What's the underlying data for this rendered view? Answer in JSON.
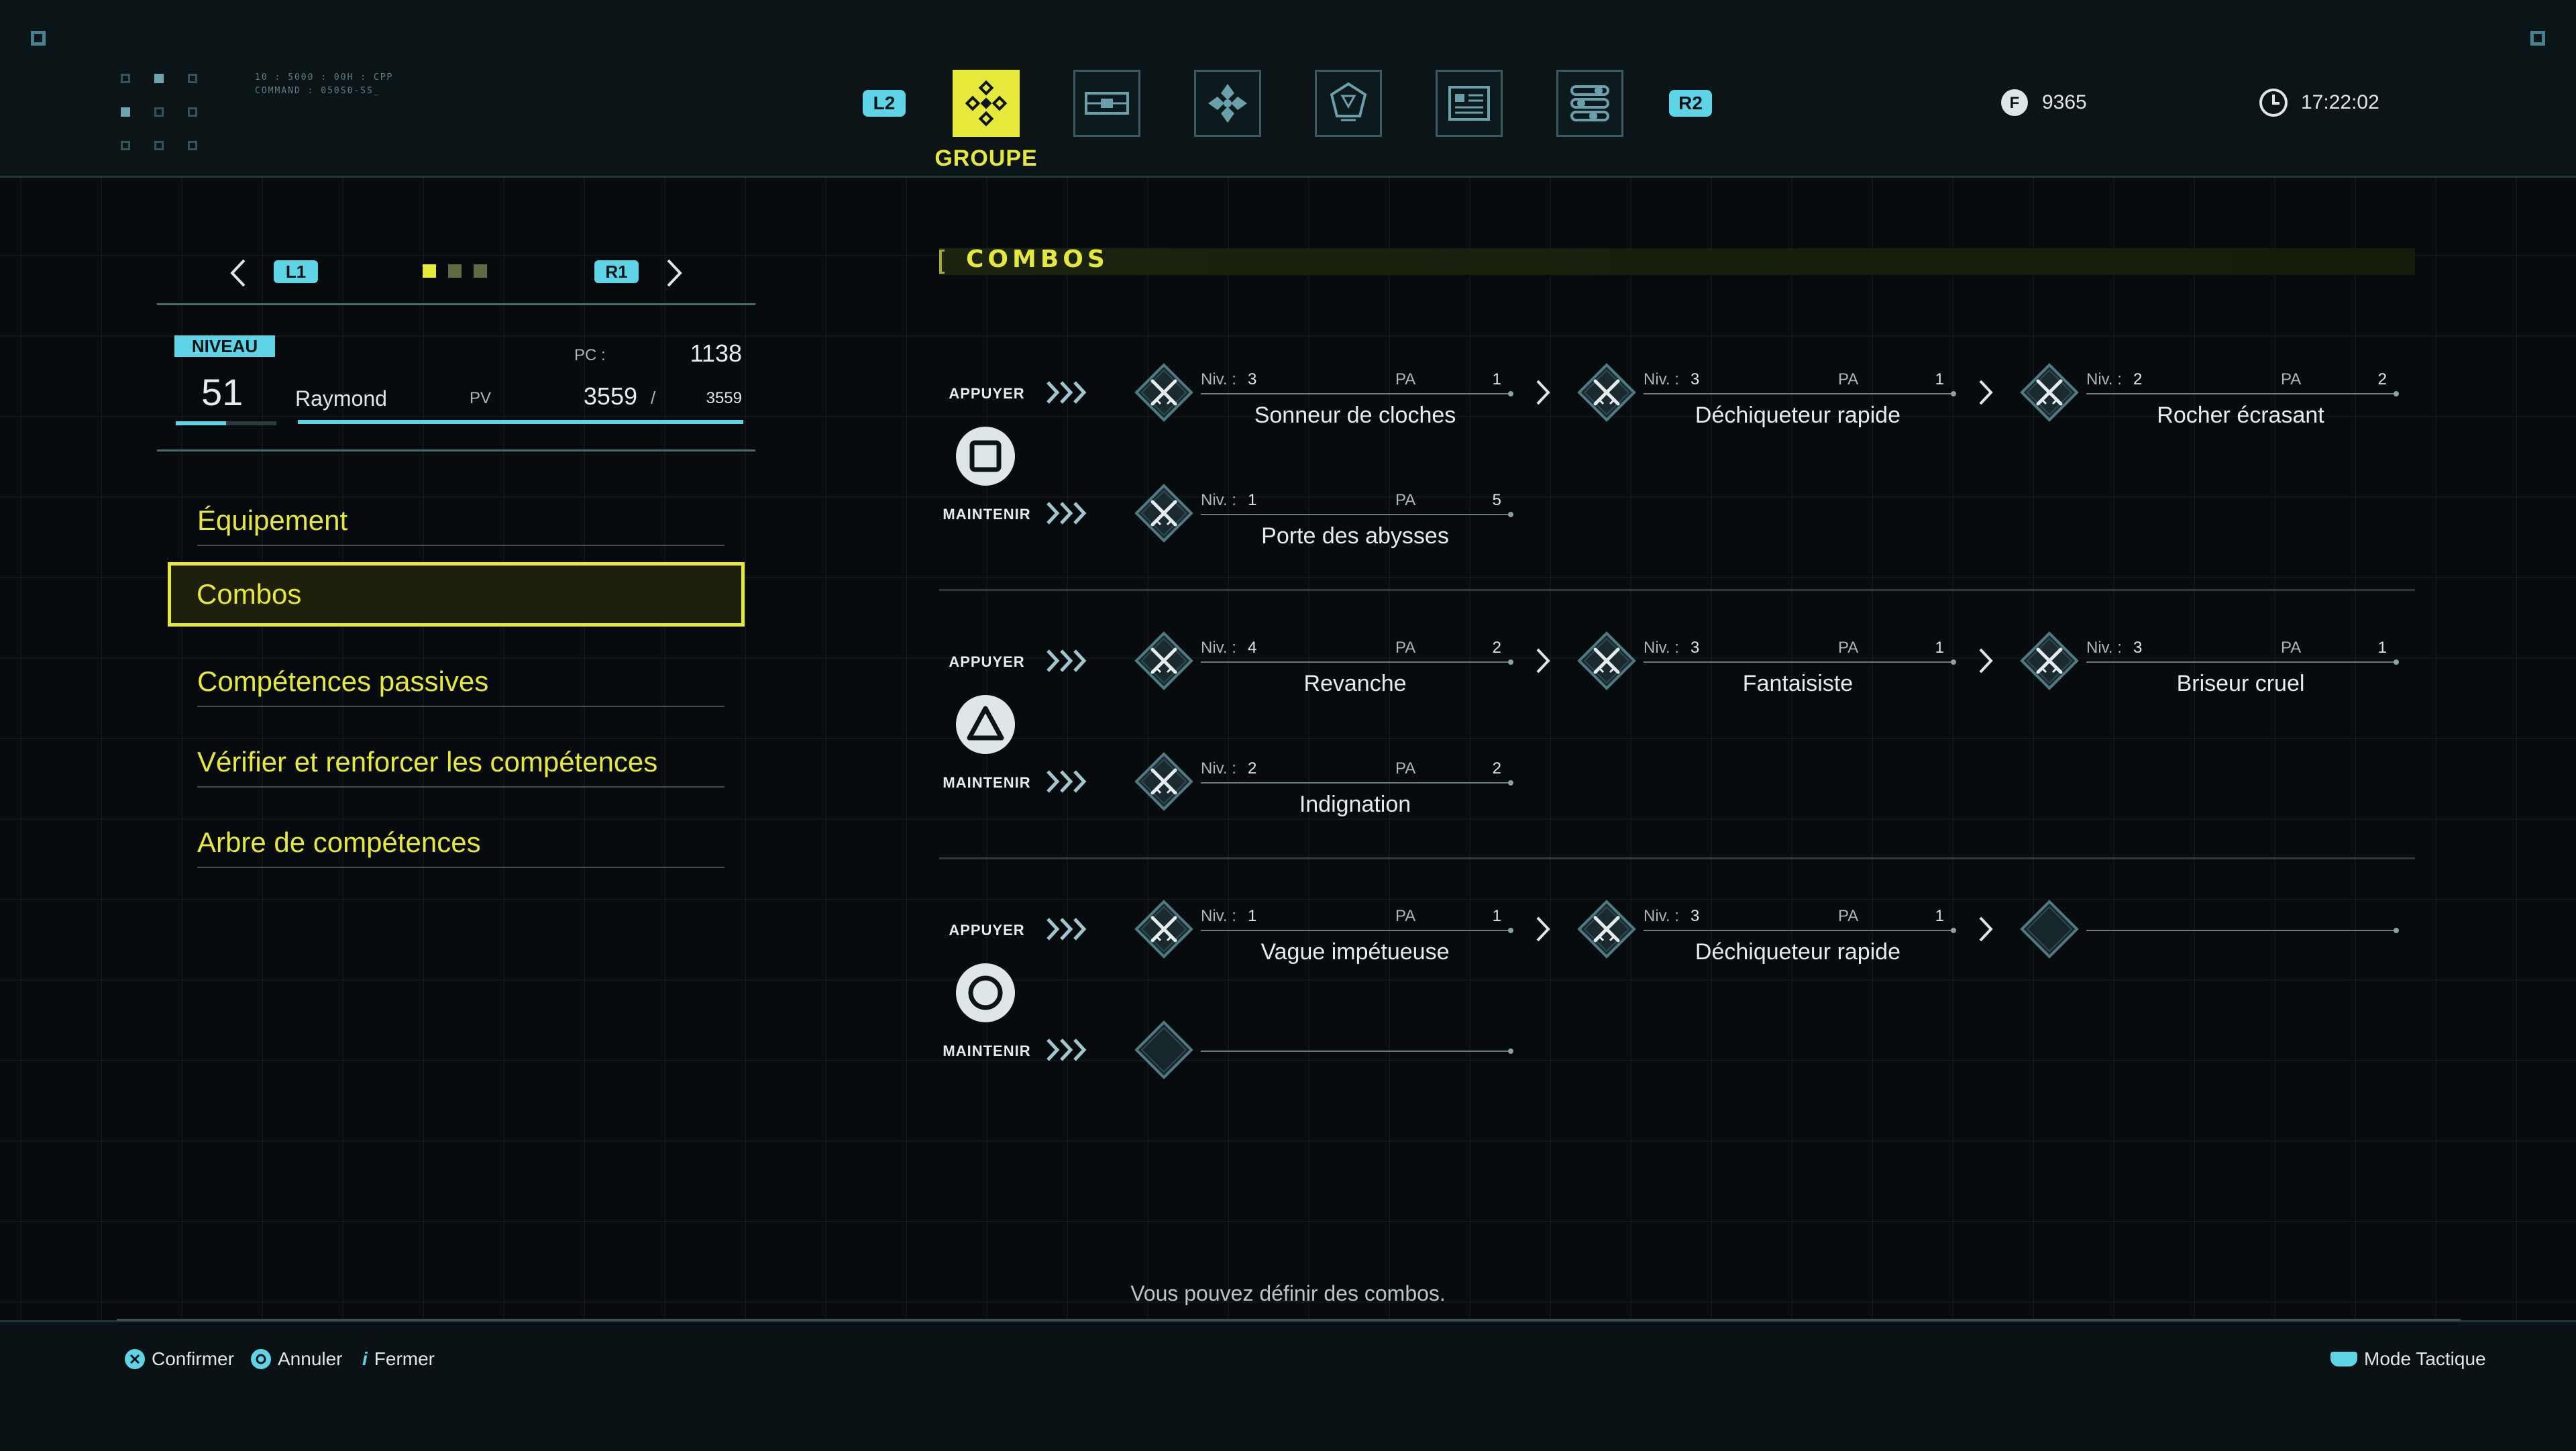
{
  "header": {
    "decor_text_line1": "10 : 5000 : 00H : CPP",
    "decor_text_line2": "COMMAND : 050S0-SS_",
    "left_trigger": "L2",
    "right_trigger": "R2",
    "tabs": [
      {
        "icon": "party-icon",
        "active": true
      },
      {
        "icon": "equipment-icon",
        "active": false
      },
      {
        "icon": "materia-icon",
        "active": false
      },
      {
        "icon": "gem-icon",
        "active": false
      },
      {
        "icon": "document-icon",
        "active": false
      },
      {
        "icon": "settings-list-icon",
        "active": false
      }
    ],
    "active_tab_label": "GROUPE",
    "currency": "9365",
    "time": "17:22:02"
  },
  "character": {
    "prev_button": "L1",
    "next_button": "R1",
    "page_dots": [
      true,
      false,
      false
    ],
    "niveau_label": "NIVEAU",
    "level": "51",
    "name": "Raymond",
    "pc_label": "PC :",
    "pc_value": "1138",
    "pv_label": "PV",
    "pv_current": "3559",
    "pv_sep": "/",
    "pv_max": "3559",
    "hp_fill": 1.0,
    "xp_fill": 0.5
  },
  "menu": {
    "items": [
      {
        "label": "Équipement",
        "selected": false
      },
      {
        "label": "Combos",
        "selected": true
      },
      {
        "label": "Compétences passives",
        "selected": false
      },
      {
        "label": "Vérifier et renforcer les compétences",
        "selected": false
      },
      {
        "label": "Arbre de compétences",
        "selected": false
      }
    ]
  },
  "combos": {
    "title": "COMBOS",
    "press_label": "APPUYER",
    "hold_label": "MAINTENIR",
    "niv_label": "Niv. :",
    "pa_label": "PA",
    "groups": [
      {
        "button": "square",
        "press": [
          {
            "level": "3",
            "pa": "1",
            "name": "Sonneur de cloches"
          },
          {
            "level": "3",
            "pa": "1",
            "name": "Déchiqueteur rapide"
          },
          {
            "level": "2",
            "pa": "2",
            "name": "Rocher écrasant"
          }
        ],
        "hold": [
          {
            "level": "1",
            "pa": "5",
            "name": "Porte des abysses"
          }
        ]
      },
      {
        "button": "triangle",
        "press": [
          {
            "level": "4",
            "pa": "2",
            "name": "Revanche"
          },
          {
            "level": "3",
            "pa": "1",
            "name": "Fantaisiste"
          },
          {
            "level": "3",
            "pa": "1",
            "name": "Briseur cruel"
          }
        ],
        "hold": [
          {
            "level": "2",
            "pa": "2",
            "name": "Indignation"
          }
        ]
      },
      {
        "button": "circle",
        "press": [
          {
            "level": "1",
            "pa": "1",
            "name": "Vague impétueuse"
          },
          {
            "level": "3",
            "pa": "1",
            "name": "Déchiqueteur rapide"
          },
          {
            "empty": true
          }
        ],
        "hold": [
          {
            "empty": true
          }
        ]
      }
    ]
  },
  "info_text": "Vous pouvez définir des combos.",
  "footer": {
    "confirm": "Confirmer",
    "cancel": "Annuler",
    "close": "Fermer",
    "tactical": "Mode Tactique"
  },
  "colors": {
    "accent_yellow": "#e6e83a",
    "accent_cyan": "#5ed4e6",
    "background": "#070b0d"
  }
}
